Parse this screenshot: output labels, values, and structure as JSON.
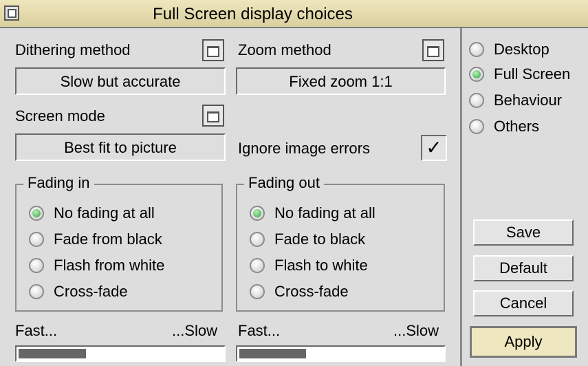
{
  "window": {
    "title": "Full Screen display choices"
  },
  "dithering": {
    "label": "Dithering method",
    "value": "Slow but accurate"
  },
  "zoom": {
    "label": "Zoom method",
    "value": "Fixed zoom 1:1"
  },
  "screen_mode": {
    "label": "Screen mode",
    "value": "Best fit to picture"
  },
  "ignore_errors": {
    "label": "Ignore image errors",
    "checked": true,
    "mark": "✓"
  },
  "fading_in": {
    "title": "Fading in",
    "options": [
      {
        "label": "No fading at all",
        "selected": true
      },
      {
        "label": "Fade from black",
        "selected": false
      },
      {
        "label": "Flash from white",
        "selected": false
      },
      {
        "label": "Cross-fade",
        "selected": false
      }
    ],
    "speed_fast": "Fast...",
    "speed_slow": "...Slow",
    "speed_fraction": 0.33
  },
  "fading_out": {
    "title": "Fading out",
    "options": [
      {
        "label": "No fading at all",
        "selected": true
      },
      {
        "label": "Fade to black",
        "selected": false
      },
      {
        "label": "Flash to white",
        "selected": false
      },
      {
        "label": "Cross-fade",
        "selected": false
      }
    ],
    "speed_fast": "Fast...",
    "speed_slow": "...Slow",
    "speed_fraction": 0.33
  },
  "categories": [
    {
      "label": "Desktop",
      "selected": false
    },
    {
      "label": "Full Screen",
      "selected": true
    },
    {
      "label": "Behaviour",
      "selected": false
    },
    {
      "label": "Others",
      "selected": false
    }
  ],
  "buttons": {
    "save": "Save",
    "default": "Default",
    "cancel": "Cancel",
    "apply": "Apply"
  }
}
